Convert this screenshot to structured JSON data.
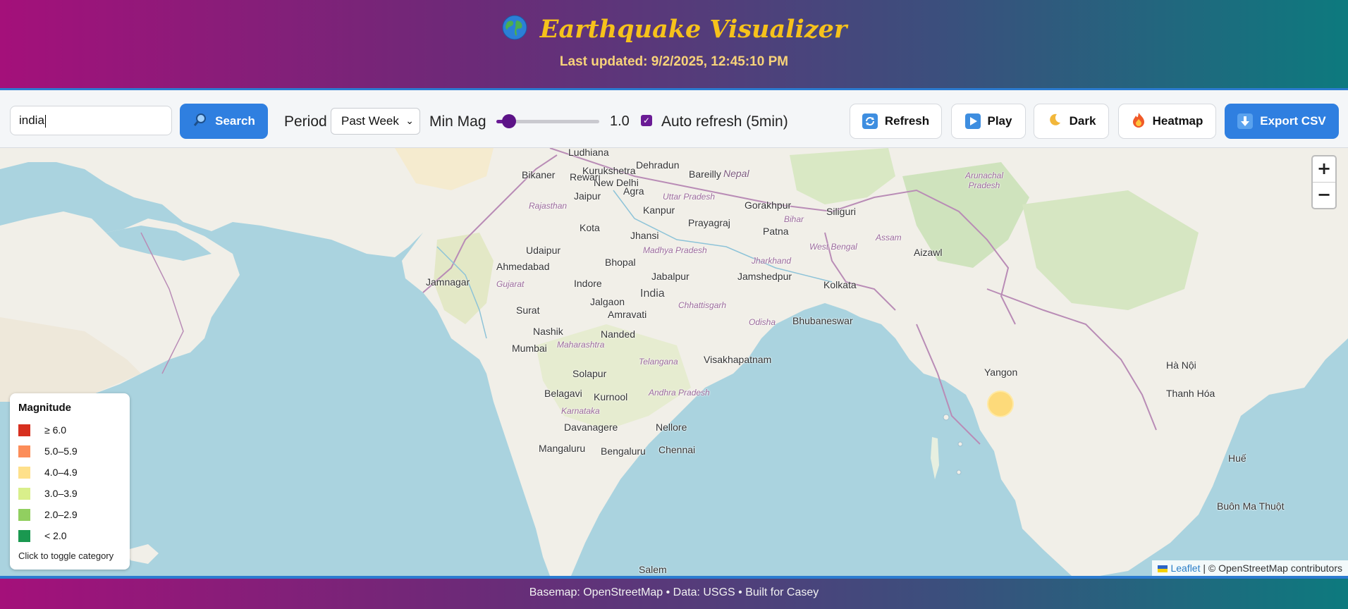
{
  "header": {
    "title": "Earthquake Visualizer",
    "subtitle": "Last updated: 9/2/2025, 12:45:10 PM",
    "icon": "globe-icon"
  },
  "toolbar": {
    "search_value": "india",
    "search_button": "Search",
    "period_label": "Period",
    "period_selected": "Past Week",
    "minmag_label": "Min Mag",
    "minmag_value": "1.0",
    "minmag_fraction": 0.0,
    "autorefresh_label": "Auto refresh (5min)",
    "autorefresh_checked": true,
    "refresh_button": "Refresh",
    "play_button": "Play",
    "dark_button": "Dark",
    "heatmap_button": "Heatmap",
    "export_button": "Export CSV"
  },
  "map": {
    "zoom_in": "+",
    "zoom_out": "−",
    "places": [
      {
        "t": "Ludhiana"
      },
      {
        "t": "Dehradun"
      },
      {
        "t": "Kurukshetra"
      },
      {
        "t": "New Delhi"
      },
      {
        "t": "Bareilly"
      },
      {
        "t": "Bikaner"
      },
      {
        "t": "Rewari"
      },
      {
        "t": "Jaipur"
      },
      {
        "t": "Agra"
      },
      {
        "t": "Uttar Pradesh"
      },
      {
        "t": "Gorakhpur"
      },
      {
        "t": "Kanpur"
      },
      {
        "t": "Prayagraj"
      },
      {
        "t": "Rajasthan"
      },
      {
        "t": "Kota"
      },
      {
        "t": "Jhansi"
      },
      {
        "t": "Patna"
      },
      {
        "t": "Bihar"
      },
      {
        "t": "Siliguri"
      },
      {
        "t": "Udaipur"
      },
      {
        "t": "Ahmedabad"
      },
      {
        "t": "Bhopal"
      },
      {
        "t": "Madhya Pradesh"
      },
      {
        "t": "Jabalpur"
      },
      {
        "t": "Jamshedpur"
      },
      {
        "t": "Jharkhand"
      },
      {
        "t": "West Bengal"
      },
      {
        "t": "Jamnagar"
      },
      {
        "t": "Gujarat"
      },
      {
        "t": "Indore"
      },
      {
        "t": "India"
      },
      {
        "t": "Kolkata"
      },
      {
        "t": "Jalgaon"
      },
      {
        "t": "Surat"
      },
      {
        "t": "Amravati"
      },
      {
        "t": "Chhattisgarh"
      },
      {
        "t": "Nashik"
      },
      {
        "t": "Nanded"
      },
      {
        "t": "Odisha"
      },
      {
        "t": "Bhubaneswar"
      },
      {
        "t": "Mumbai"
      },
      {
        "t": "Maharashtra"
      },
      {
        "t": "Visakhapatnam"
      },
      {
        "t": "Telangana"
      },
      {
        "t": "Solapur"
      },
      {
        "t": "Belagavi"
      },
      {
        "t": "Kurnool"
      },
      {
        "t": "Andhra Pradesh"
      },
      {
        "t": "Karnataka"
      },
      {
        "t": "Davanagere"
      },
      {
        "t": "Nellore"
      },
      {
        "t": "Mangaluru"
      },
      {
        "t": "Bengaluru"
      },
      {
        "t": "Chennai"
      },
      {
        "t": "Salem"
      },
      {
        "t": "Aizawl"
      },
      {
        "t": "Assam"
      },
      {
        "t": "Arunachal Pradesh"
      },
      {
        "t": "Hà Nội"
      },
      {
        "t": "Thanh Hóa"
      },
      {
        "t": "Huế"
      },
      {
        "t": "Buôn Ma Thuột"
      },
      {
        "t": "Nepal"
      },
      {
        "t": "Yangon"
      }
    ],
    "quake_magnitude_category": "4.0–4.9"
  },
  "legend": {
    "title": "Magnitude",
    "items": [
      {
        "label": "≥ 6.0",
        "color": "#d7301f"
      },
      {
        "label": "5.0–5.9",
        "color": "#fc8d59"
      },
      {
        "label": "4.0–4.9",
        "color": "#fee08b"
      },
      {
        "label": "3.0–3.9",
        "color": "#d9ef8b"
      },
      {
        "label": "2.0–2.9",
        "color": "#91cf60"
      },
      {
        "label": "< 2.0",
        "color": "#1a9850"
      }
    ],
    "note": "Click to toggle category"
  },
  "attribution": {
    "leaflet": "Leaflet",
    "rest": " | © OpenStreetMap contributors"
  },
  "footer": {
    "text": "Basemap: OpenStreetMap • Data: USGS • Built for Casey"
  }
}
